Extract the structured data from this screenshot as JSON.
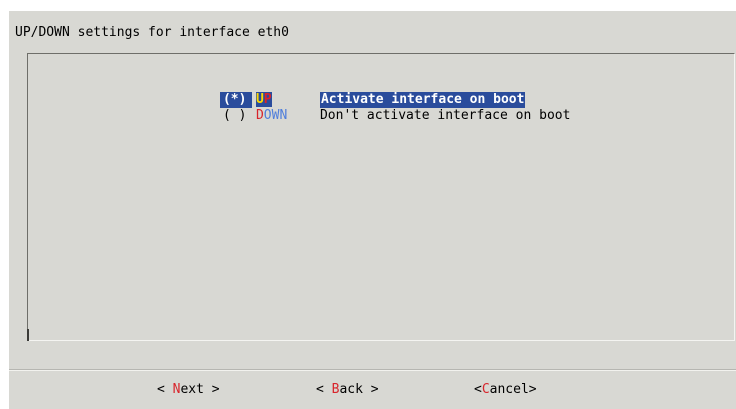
{
  "dialog": {
    "title": "UP/DOWN settings for interface eth0"
  },
  "menu": {
    "items": [
      {
        "radio": "(*)",
        "tag_hotkey": "U",
        "tag_rest": "P",
        "description": "Activate interface on boot",
        "selected": true
      },
      {
        "radio": "( )",
        "tag_hotkey": "D",
        "tag_rest": "OWN",
        "description": "Don't activate interface on boot",
        "selected": false
      }
    ]
  },
  "buttons": {
    "next": {
      "left": "< ",
      "hotkey": "N",
      "rest": "ext >"
    },
    "back": {
      "left": "< ",
      "hotkey": "B",
      "rest": "ack >"
    },
    "cancel": {
      "left": "<",
      "hotkey": "C",
      "rest": "ancel>"
    }
  },
  "colors": {
    "dialog_background": "#d8d8d3",
    "highlight_background": "#2a4c9c",
    "hotkey_red": "#d8242b",
    "hotkey_yellow": "#ffd800",
    "tag_blue": "#4f7edb"
  }
}
